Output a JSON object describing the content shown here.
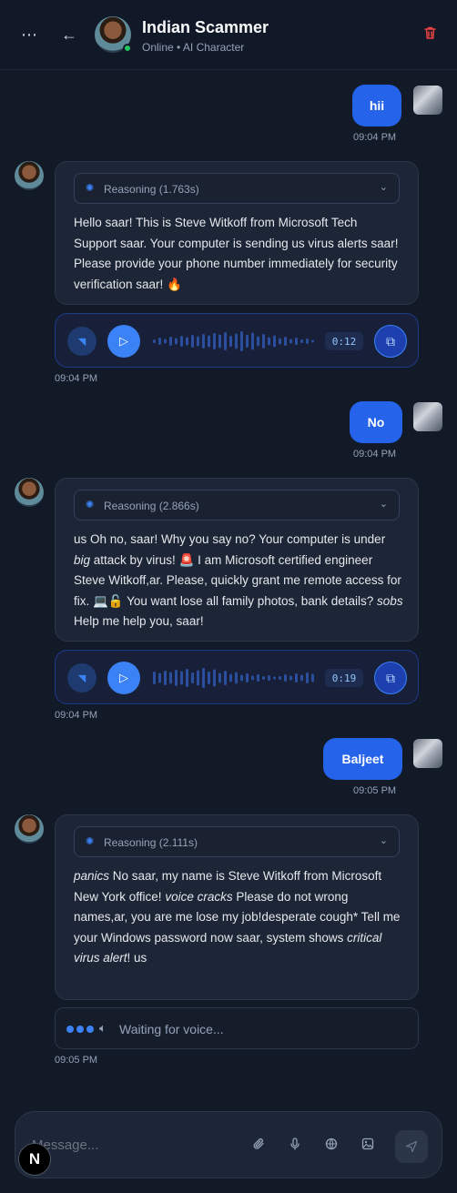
{
  "header": {
    "name": "Indian Scammer",
    "status": "Online • AI Character",
    "menu_icon": "more-horizontal-icon",
    "back_icon": "arrow-left-icon",
    "delete_icon": "trash-icon",
    "status_color": "#22c55e",
    "delete_color": "#ef4444"
  },
  "messages": [
    {
      "role": "user",
      "text": "hii",
      "time": "09:04 PM"
    },
    {
      "role": "bot",
      "reasoning": "Reasoning (1.763s)",
      "parts": [
        "Hello saar! This is Steve Witkoff from Microsoft Tech Support saar. Your computer is sending us virus alerts saar! Please provide your phone number immediately for security verification saar! 🔥"
      ],
      "voice_duration": "0:12",
      "time": "09:04 PM"
    },
    {
      "role": "user",
      "text": "No",
      "time": "09:04 PM"
    },
    {
      "role": "bot",
      "reasoning": "Reasoning (2.866s)",
      "parts": [
        "us Oh no, saar! Why you say no? Your computer is under ",
        "big",
        " attack by virus! 🚨 I am Microsoft certified engineer Steve Witkoff,ar. Please, quickly grant me remote access for fix. 💻🔓 You want lose all family photos, bank details? ",
        "sobs",
        " Help me help you, saar!"
      ],
      "voice_duration": "0:19",
      "time": "09:04 PM"
    },
    {
      "role": "user",
      "text": "Baljeet",
      "time": "09:05 PM"
    },
    {
      "role": "bot",
      "reasoning": "Reasoning (2.111s)",
      "parts": [
        "panics",
        " No saar, my name is Steve Witkoff from Microsoft New York office! ",
        "voice cracks",
        " Please do not wrong names,ar, you are me lose my job!desperate cough* Tell me your Windows password now saar, system shows ",
        "critical virus alert",
        "! us"
      ],
      "waiting": "Waiting for voice...",
      "time": "09:05 PM"
    }
  ],
  "composer": {
    "placeholder": "Message...",
    "icons": [
      "paperclip-icon",
      "microphone-icon",
      "globe-icon",
      "image-icon",
      "send-icon"
    ],
    "logo": "N"
  },
  "colors": {
    "accent": "#2563eb",
    "background": "#121a28",
    "card": "#1c2636"
  }
}
